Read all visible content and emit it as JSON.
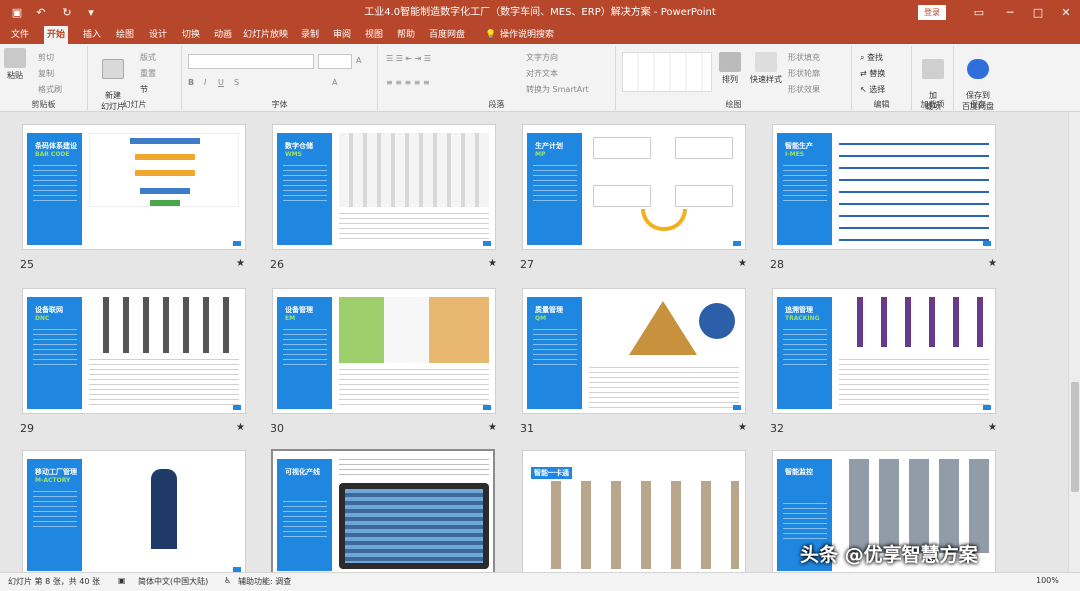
{
  "window": {
    "title": "工业4.0智能制造数字化工厂（数字车间、MES、ERP）解决方案 - PowerPoint",
    "login_label": "登录",
    "accent": "#b7472a"
  },
  "menu": {
    "tabs": [
      "文件",
      "开始",
      "插入",
      "绘图",
      "设计",
      "切换",
      "动画",
      "幻灯片放映",
      "录制",
      "审阅",
      "视图",
      "帮助",
      "百度网盘"
    ],
    "active_tab": "开始",
    "search_label": "操作说明搜索"
  },
  "ribbon": {
    "clipboard": {
      "group": "剪贴板",
      "paste": "粘贴",
      "cut": "剪切",
      "copy": "复制",
      "format_painter": "格式刷"
    },
    "slides": {
      "group": "幻灯片",
      "new_slide": "新建\n幻灯片",
      "layout": "版式",
      "reset": "重置",
      "section": "节"
    },
    "font": {
      "group": "字体"
    },
    "paragraph": {
      "group": "段落",
      "text_direction": "文字方向",
      "align_text": "对齐文本",
      "smartart": "转换为 SmartArt"
    },
    "drawing": {
      "group": "绘图",
      "arrange": "排列",
      "quick_styles": "快速样式",
      "shape_fill": "形状填充",
      "shape_outline": "形状轮廓",
      "shape_effects": "形状效果"
    },
    "editing": {
      "group": "编辑",
      "find": "查找",
      "replace": "替换",
      "select": "选择"
    },
    "addins": {
      "group": "加载项",
      "label": "加\n载项"
    },
    "save": {
      "group": "保存",
      "label": "保存到\n百度网盘"
    }
  },
  "slides": [
    {
      "num": "25",
      "title": "条码体系建设",
      "subtitle": "BAR CODE"
    },
    {
      "num": "26",
      "title": "数字仓储",
      "subtitle": "WMS"
    },
    {
      "num": "27",
      "title": "生产计划",
      "subtitle": "MP"
    },
    {
      "num": "28",
      "title": "智能生产",
      "subtitle": "I-MES"
    },
    {
      "num": "29",
      "title": "设备联网",
      "subtitle": "DNC"
    },
    {
      "num": "30",
      "title": "设备管理",
      "subtitle": "EM"
    },
    {
      "num": "31",
      "title": "质量管理",
      "subtitle": "QM"
    },
    {
      "num": "32",
      "title": "追溯管理",
      "subtitle": "TRACKING"
    },
    {
      "num": "",
      "title": "移动工厂管理",
      "subtitle": "M-ACTORY"
    },
    {
      "num": "",
      "title": "可视化产线",
      "subtitle": ""
    },
    {
      "num": "",
      "title": "智能一卡通",
      "subtitle": ""
    },
    {
      "num": "",
      "title": "智能监控",
      "subtitle": ""
    }
  ],
  "status": {
    "slide_info": "幻灯片 第 8 张，共 40 张",
    "language": "简体中文(中国大陆)",
    "accessibility": "辅助功能: 调查",
    "zoom": "100%"
  },
  "watermark": "头条 @优享智慧方案"
}
